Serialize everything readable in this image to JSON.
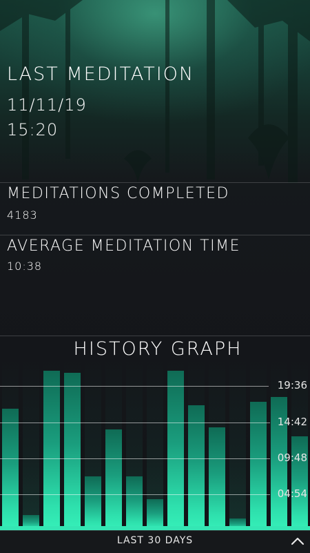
{
  "last_meditation": {
    "title": "LAST MEDITATION",
    "date": "11/11/19",
    "time": "15:20"
  },
  "stats": {
    "completed_title": "MEDITATIONS COMPLETED",
    "completed_value": "4183",
    "average_title": "AVERAGE MEDITATION TIME",
    "average_value": "10:38"
  },
  "graph": {
    "title": "HISTORY GRAPH",
    "range_label": "LAST 30 DAYS",
    "expand_icon": "chevron-up-icon"
  },
  "chart_data": {
    "type": "bar",
    "y_ticks": [
      "19:36",
      "14:42",
      "09:48",
      "04:54"
    ],
    "y_tick_minutes": [
      19.6,
      14.7,
      9.8,
      4.9
    ],
    "ylim": [
      0,
      23.3
    ],
    "values": [
      16.5,
      2.1,
      21.7,
      21.4,
      7.3,
      13.7,
      7.3,
      4.2,
      21.7,
      17.0,
      14.0,
      1.6,
      17.5,
      18.1,
      12.8
    ],
    "bar_color": "#36f0b9"
  }
}
